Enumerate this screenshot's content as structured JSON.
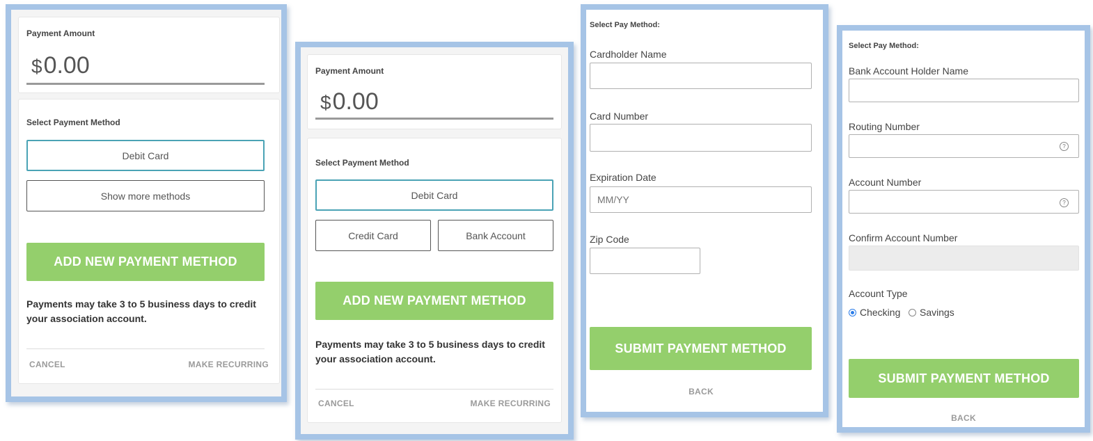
{
  "panel1": {
    "amount_label": "Payment Amount",
    "currency": "$",
    "amount_value": "0.00",
    "method_label": "Select Payment Method",
    "method_selected": "Debit Card",
    "show_more": "Show more methods",
    "add_button": "ADD NEW PAYMENT METHOD",
    "note": "Payments may take 3 to 5 business days to credit your association account.",
    "cancel": "CANCEL",
    "recurring": "MAKE RECURRING"
  },
  "panel2": {
    "amount_label": "Payment Amount",
    "currency": "$",
    "amount_value": "0.00",
    "method_label": "Select Payment Method",
    "method_selected": "Debit Card",
    "method_credit": "Credit Card",
    "method_bank": "Bank Account",
    "add_button": "ADD NEW PAYMENT METHOD",
    "note": "Payments may take 3 to 5 business days to credit your association account.",
    "cancel": "CANCEL",
    "recurring": "MAKE RECURRING"
  },
  "panel3": {
    "header": "Select Pay Method:",
    "cardholder_label": "Cardholder Name",
    "cardholder_value": "",
    "card_number_label": "Card Number",
    "card_number_value": "",
    "expiration_label": "Expiration Date",
    "expiration_placeholder": "MM/YY",
    "zip_label": "Zip Code",
    "zip_value": "",
    "submit": "SUBMIT PAYMENT METHOD",
    "back": "BACK"
  },
  "panel4": {
    "header": "Select Pay Method:",
    "holder_label": "Bank Account Holder Name",
    "routing_label": "Routing Number",
    "account_label": "Account Number",
    "confirm_label": "Confirm Account Number",
    "account_type_label": "Account Type",
    "type_checking": "Checking",
    "type_savings": "Savings",
    "selected_type": "Checking",
    "help_icon_glyph": "?",
    "submit": "SUBMIT PAYMENT METHOD",
    "back": "BACK"
  },
  "colors": {
    "frame_border": "#a6c4e6",
    "green_button": "#94cf6c",
    "selected_outline": "#4aa3b5",
    "radio_accent": "#2b7de9"
  }
}
